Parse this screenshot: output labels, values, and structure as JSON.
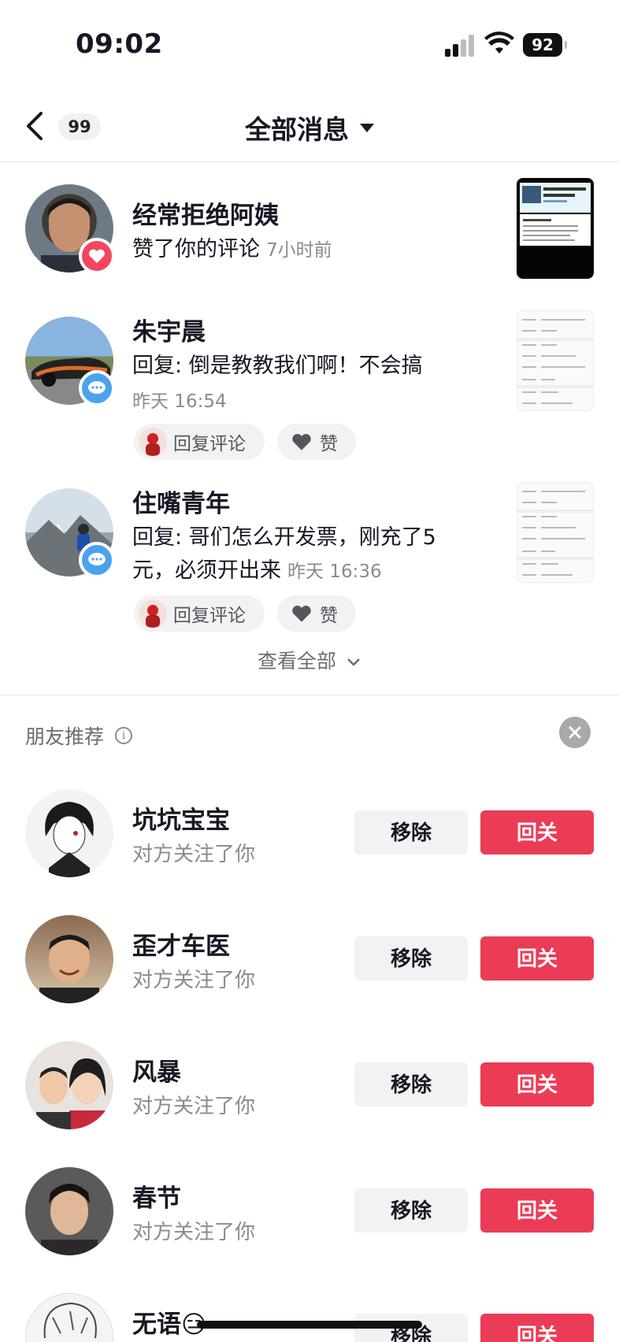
{
  "status_bar": {
    "time": "09:02",
    "battery": "92"
  },
  "nav": {
    "badge_count": "99",
    "title": "全部消息"
  },
  "messages": [
    {
      "name": "经常拒绝阿姨",
      "text": "赞了你的评论",
      "time": "7小时前",
      "badge": "heart-icon"
    },
    {
      "name": "朱宇晨",
      "text": "回复: 倒是教教我们啊！不会搞",
      "time": "昨天 16:54",
      "badge": "chat-icon",
      "actions": {
        "reply": "回复评论",
        "like": "赞"
      }
    },
    {
      "name": "住嘴青年",
      "text": "回复: 哥们怎么开发票，刚充了5元，必须开出来",
      "time": "昨天 16:36",
      "badge": "chat-icon",
      "actions": {
        "reply": "回复评论",
        "like": "赞"
      }
    }
  ],
  "see_all": "查看全部",
  "friends": {
    "title": "朋友推荐",
    "remove_label": "移除",
    "follow_label": "回关",
    "items": [
      {
        "name": "坑坑宝宝",
        "sub": "对方关注了你"
      },
      {
        "name": "歪才车医",
        "sub": "对方关注了你"
      },
      {
        "name": "风暴",
        "sub": "对方关注了你"
      },
      {
        "name": "春节",
        "sub": "对方关注了你"
      },
      {
        "name": "无语😑",
        "sub": ""
      }
    ]
  },
  "colors": {
    "accent_red": "#ea3c57",
    "heart": "#f2465e",
    "chat": "#4aa3ec"
  }
}
